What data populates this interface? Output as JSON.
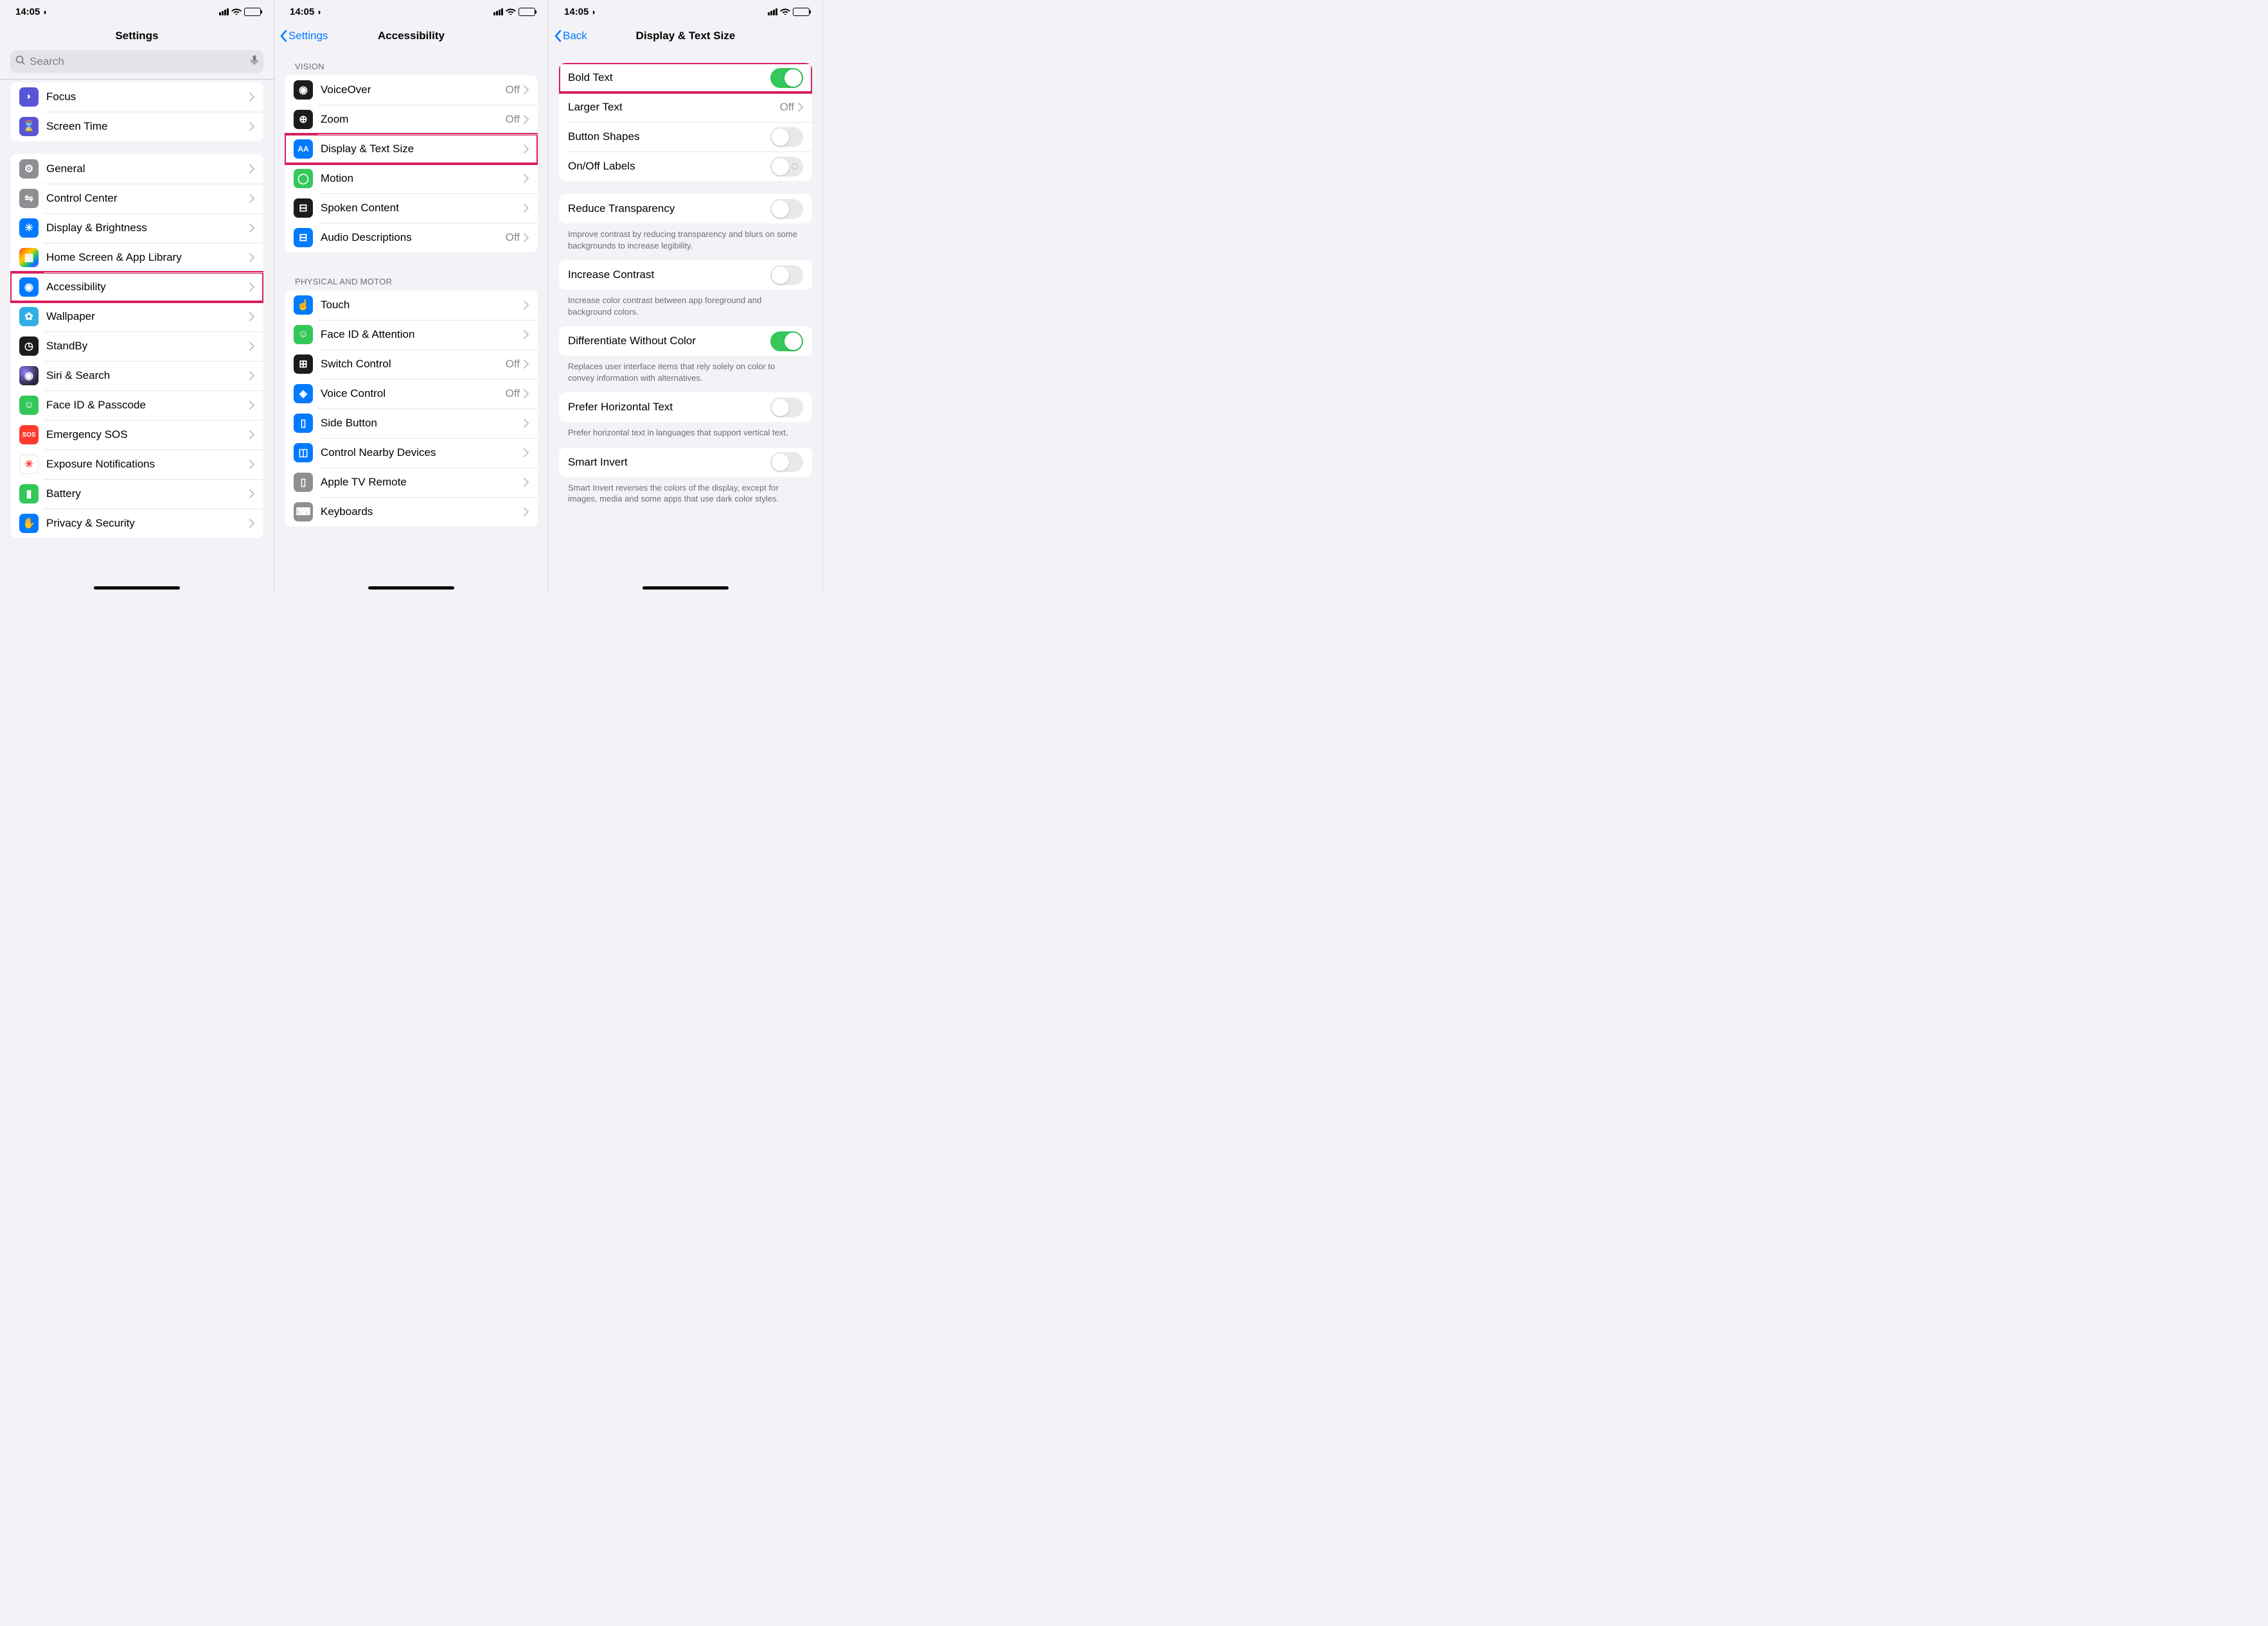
{
  "status": {
    "time": "14:05"
  },
  "screen1": {
    "title": "Settings",
    "search_placeholder": "Search",
    "groups": [
      {
        "items": [
          {
            "label": "Focus",
            "icon": "moon",
            "color": "ic-purple"
          },
          {
            "label": "Screen Time",
            "icon": "hourglass",
            "color": "ic-indigo"
          }
        ]
      },
      {
        "items": [
          {
            "label": "General",
            "icon": "gear",
            "color": "ic-gray"
          },
          {
            "label": "Control Center",
            "icon": "switches",
            "color": "ic-gray"
          },
          {
            "label": "Display & Brightness",
            "icon": "sun",
            "color": "ic-blue"
          },
          {
            "label": "Home Screen & App Library",
            "icon": "grid",
            "color": "ic-rainbow"
          },
          {
            "label": "Accessibility",
            "icon": "accessibility",
            "color": "ic-blue",
            "highlight": true
          },
          {
            "label": "Wallpaper",
            "icon": "flower",
            "color": "ic-cyan"
          },
          {
            "label": "StandBy",
            "icon": "clock",
            "color": "ic-black"
          },
          {
            "label": "Siri & Search",
            "icon": "siri",
            "color": "ic-siri"
          },
          {
            "label": "Face ID & Passcode",
            "icon": "faceid",
            "color": "ic-green"
          },
          {
            "label": "Emergency SOS",
            "icon": "sos",
            "color": "ic-red"
          },
          {
            "label": "Exposure Notifications",
            "icon": "exposure",
            "color": "ic-white"
          },
          {
            "label": "Battery",
            "icon": "battery",
            "color": "ic-green"
          },
          {
            "label": "Privacy & Security",
            "icon": "hand",
            "color": "ic-blue"
          }
        ]
      }
    ]
  },
  "screen2": {
    "back": "Settings",
    "title": "Accessibility",
    "sections": [
      {
        "header": "VISION",
        "items": [
          {
            "label": "VoiceOver",
            "value": "Off",
            "icon": "voiceover",
            "color": "ic-black"
          },
          {
            "label": "Zoom",
            "value": "Off",
            "icon": "zoom",
            "color": "ic-black"
          },
          {
            "label": "Display & Text Size",
            "icon": "aa",
            "color": "ic-blue",
            "highlight": true
          },
          {
            "label": "Motion",
            "icon": "motion",
            "color": "ic-green"
          },
          {
            "label": "Spoken Content",
            "icon": "spoken",
            "color": "ic-black"
          },
          {
            "label": "Audio Descriptions",
            "value": "Off",
            "icon": "audiodesc",
            "color": "ic-blue"
          }
        ]
      },
      {
        "header": "PHYSICAL AND MOTOR",
        "items": [
          {
            "label": "Touch",
            "icon": "touch",
            "color": "ic-blue"
          },
          {
            "label": "Face ID & Attention",
            "icon": "faceid",
            "color": "ic-green"
          },
          {
            "label": "Switch Control",
            "value": "Off",
            "icon": "switch",
            "color": "ic-black"
          },
          {
            "label": "Voice Control",
            "value": "Off",
            "icon": "voice",
            "color": "ic-blue"
          },
          {
            "label": "Side Button",
            "icon": "sidebutton",
            "color": "ic-blue"
          },
          {
            "label": "Control Nearby Devices",
            "icon": "nearby",
            "color": "ic-blue"
          },
          {
            "label": "Apple TV Remote",
            "icon": "remote",
            "color": "ic-gray"
          },
          {
            "label": "Keyboards",
            "icon": "keyboard",
            "color": "ic-gray"
          }
        ]
      }
    ]
  },
  "screen3": {
    "back": "Back",
    "title": "Display & Text Size",
    "groups": [
      {
        "items": [
          {
            "label": "Bold Text",
            "toggle": "on",
            "highlight": true
          },
          {
            "label": "Larger Text",
            "value": "Off",
            "chevron": true
          },
          {
            "label": "Button Shapes",
            "toggle": "off"
          },
          {
            "label": "On/Off Labels",
            "toggle": "off",
            "toggle_label": true
          }
        ]
      },
      {
        "items": [
          {
            "label": "Reduce Transparency",
            "toggle": "off"
          }
        ],
        "footer": "Improve contrast by reducing transparency and blurs on some backgrounds to increase legibility."
      },
      {
        "items": [
          {
            "label": "Increase Contrast",
            "toggle": "off"
          }
        ],
        "footer": "Increase color contrast between app foreground and background colors."
      },
      {
        "items": [
          {
            "label": "Differentiate Without Color",
            "toggle": "on"
          }
        ],
        "footer": "Replaces user interface items that rely solely on color to convey information with alternatives."
      },
      {
        "items": [
          {
            "label": "Prefer Horizontal Text",
            "toggle": "off"
          }
        ],
        "footer": "Prefer horizontal text in languages that support vertical text."
      },
      {
        "items": [
          {
            "label": "Smart Invert",
            "toggle": "off"
          }
        ],
        "footer": "Smart Invert reverses the colors of the display, except for images, media and some apps that use dark color styles."
      }
    ]
  }
}
